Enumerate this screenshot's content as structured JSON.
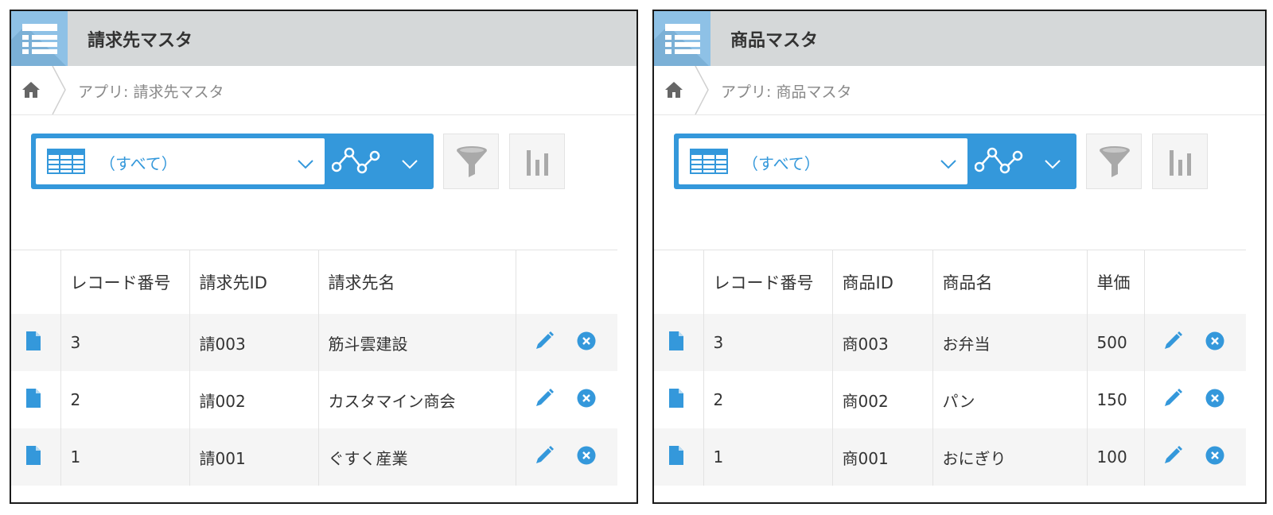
{
  "left_app": {
    "title": "請求先マスタ",
    "breadcrumb": "アプリ: 請求先マスタ",
    "view_label": "（すべて）",
    "columns": [
      "レコード番号",
      "請求先ID",
      "請求先名"
    ],
    "rows": [
      {
        "record_no": "3",
        "id": "請003",
        "name": "筋斗雲建設"
      },
      {
        "record_no": "2",
        "id": "請002",
        "name": "カスタマイン商会"
      },
      {
        "record_no": "1",
        "id": "請001",
        "name": "ぐすく産業"
      }
    ]
  },
  "right_app": {
    "title": "商品マスタ",
    "breadcrumb": "アプリ: 商品マスタ",
    "view_label": "（すべて）",
    "columns": [
      "レコード番号",
      "商品ID",
      "商品名",
      "単価"
    ],
    "rows": [
      {
        "record_no": "3",
        "id": "商003",
        "name": "お弁当",
        "price": "500"
      },
      {
        "record_no": "2",
        "id": "商002",
        "name": "パン",
        "price": "150"
      },
      {
        "record_no": "1",
        "id": "商001",
        "name": "おにぎり",
        "price": "100"
      }
    ]
  },
  "icons": {
    "app": "list-icon",
    "home": "home-icon",
    "view": "table-grid-icon",
    "graph": "graph-icon",
    "filter": "filter-icon",
    "chart": "bar-chart-icon",
    "record": "document-icon",
    "edit": "pencil-icon",
    "delete": "close-circle-icon"
  },
  "colors": {
    "accent": "#3498db",
    "title_bar": "#d5d8d9",
    "app_icon": "#8ec1e6",
    "row_alt": "#f5f5f5"
  }
}
